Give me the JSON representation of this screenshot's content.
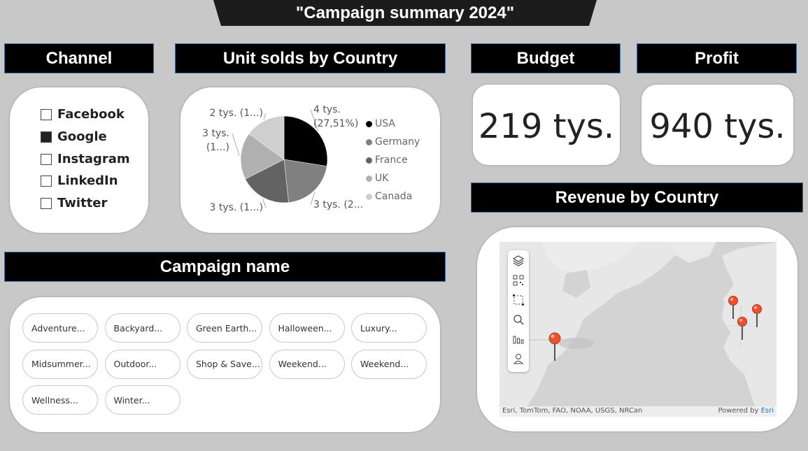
{
  "title": "\"Campaign summary 2024\"",
  "headers": {
    "channel": "Channel",
    "units_by_country": "Unit solds by Country",
    "budget": "Budget",
    "profit": "Profit",
    "revenue_by_country": "Revenue by Country",
    "campaign_name": "Campaign name"
  },
  "channel_slicer": {
    "items": [
      {
        "label": "Facebook",
        "checked": false
      },
      {
        "label": "Google",
        "checked": true
      },
      {
        "label": "Instagram",
        "checked": false
      },
      {
        "label": "LinkedIn",
        "checked": false
      },
      {
        "label": "Twitter",
        "checked": false
      }
    ]
  },
  "chart_data": {
    "type": "pie",
    "title": "Unit solds by Country",
    "slices": [
      {
        "name": "USA",
        "value": 27.51,
        "color": "#000000",
        "label": "4 tys. (27,51%)"
      },
      {
        "name": "Germany",
        "value": 20.8,
        "color": "#808080",
        "label": "3 tys. (2...)"
      },
      {
        "name": "France",
        "value": 19.2,
        "color": "#636363",
        "label": "3 tys. (1...)"
      },
      {
        "name": "UK",
        "value": 17.5,
        "color": "#b0b0b0",
        "label": "3 tys. (1...)"
      },
      {
        "name": "Canada",
        "value": 14.99,
        "color": "#cfcfcf",
        "label": "2 tys. (1...)"
      }
    ],
    "legend_position": "right"
  },
  "kpis": {
    "budget_value": "219 tys.",
    "profit_value": "940 tys."
  },
  "campaigns": [
    "Adventure...",
    "Backyard...",
    "Green Earth...",
    "Halloween...",
    "Luxury...",
    "Midsummer...",
    "Outdoor...",
    "Shop & Save...",
    "Weekend...",
    "Weekend...",
    "Wellness...",
    "Winter..."
  ],
  "map": {
    "attribution": "Esri, TomTom, FAO, NOAA, USGS, NRCan",
    "powered_by_prefix": "Powered by ",
    "powered_by_brand": "Esri",
    "tools": [
      "layers-icon",
      "qr-select-icon",
      "rectangle-select-icon",
      "search-icon",
      "bar-chart-icon",
      "user-location-icon"
    ],
    "pin_locations": [
      "USA",
      "UK",
      "France",
      "Germany"
    ]
  }
}
